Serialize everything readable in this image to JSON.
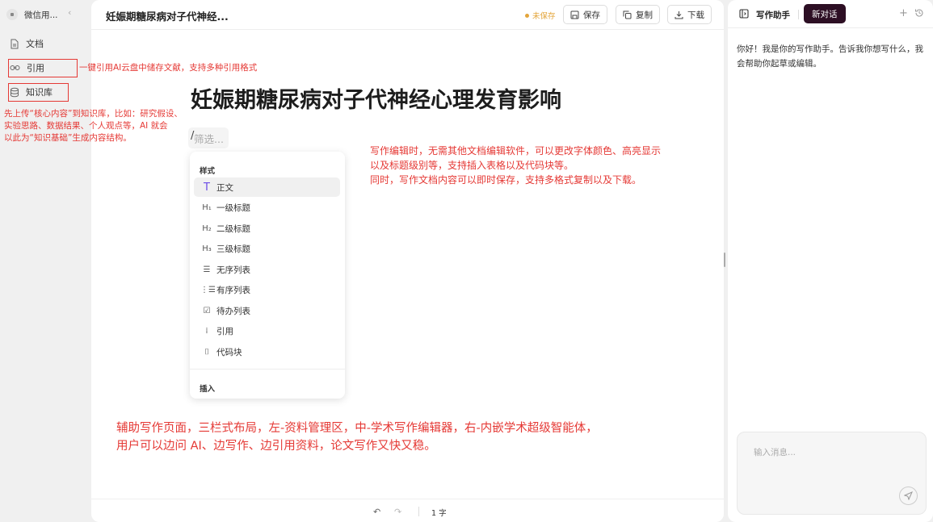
{
  "sidebar": {
    "workspace_name": "微信用...",
    "collapse_glyph": "‹",
    "items": [
      {
        "label": "文档",
        "icon": "document-icon"
      },
      {
        "label": "引用",
        "icon": "link-icon"
      },
      {
        "label": "知识库",
        "icon": "database-icon"
      }
    ]
  },
  "editor": {
    "doc_title": "妊娠期糖尿病对子代神经...",
    "status": "未保存",
    "buttons": {
      "save": "保存",
      "copy": "复制",
      "download": "下载"
    },
    "heading": "妊娠期糖尿病对子代神经心理发育影响",
    "slash": "/",
    "filter_placeholder": "筛选...",
    "menu": {
      "section_style": "样式",
      "items": [
        {
          "icon": "T",
          "label": "正文"
        },
        {
          "icon": "H₁",
          "label": "一级标题"
        },
        {
          "icon": "H₂",
          "label": "二级标题"
        },
        {
          "icon": "H₃",
          "label": "三级标题"
        },
        {
          "icon": "☰",
          "label": "无序列表"
        },
        {
          "icon": "⋮☰",
          "label": "有序列表"
        },
        {
          "icon": "☑",
          "label": "待办列表"
        },
        {
          "icon": "⁞",
          "label": "引用"
        },
        {
          "icon": "⌷",
          "label": "代码块"
        }
      ],
      "section_insert": "插入"
    },
    "undo_glyph": "↶",
    "redo_glyph": "↷",
    "word_count": "1 字"
  },
  "assistant": {
    "title": "写作助手",
    "new_chat": "新对话",
    "plus_glyph": "+",
    "greeting": "你好！我是你的写作助手。告诉我你想写什么，我会帮助你起草或编辑。",
    "input_placeholder": "输入消息..."
  },
  "annotations": {
    "cite": "一键引用AI云盘中储存文献，支持多种引用格式",
    "kb": [
      "先上传“核心内容”到知识库，比如：研究假设、",
      "实验思路、数据结果、个人观点等，AI 就会",
      "以此为“知识基础”生成内容结构。"
    ],
    "editor": [
      "写作编辑时，无需其他文档编辑软件，可以更改字体颜色、高亮显示",
      "以及标题级别等，支持插入表格以及代码块等。",
      "同时，写作文档内容可以即时保存，支持多格式复制以及下载。"
    ],
    "layout": [
      "辅助写作页面，三栏式布局，左-资料管理区，中-学术写作编辑器，右-内嵌学术超级智能体，",
      "用户可以边问 AI、边写作、边引用资料，论文写作又快又稳。"
    ]
  },
  "colors": {
    "annotation": "#e53935",
    "new_chat_bg": "#2d0f24",
    "unsaved": "#e3a53b",
    "accent_icon": "#6b4de6"
  }
}
